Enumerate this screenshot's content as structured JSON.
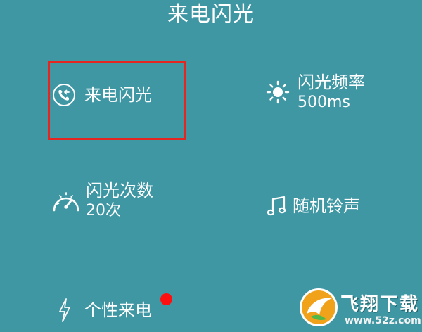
{
  "header": {
    "title": "来电闪光"
  },
  "tiles": {
    "incoming_flash": {
      "label": "来电闪光",
      "icon": "phone-incoming-icon"
    },
    "flash_frequency": {
      "label": "闪光频率",
      "value": "500ms",
      "icon": "sun-icon"
    },
    "flash_count": {
      "label": "闪光次数",
      "value": "20次",
      "icon": "gauge-icon"
    },
    "random_ringtone": {
      "label": "随机铃声",
      "icon": "music-note-icon"
    },
    "personal_call": {
      "label": "个性来电",
      "icon": "lightning-icon",
      "badge": "red-dot"
    }
  },
  "annotation": {
    "highlight_color": "#e52620"
  },
  "watermark": {
    "title": "飞翔下载",
    "url": "www.52z.com"
  },
  "colors": {
    "background": "#3f97a4",
    "text": "#ffffff",
    "badge": "#ff1010"
  }
}
